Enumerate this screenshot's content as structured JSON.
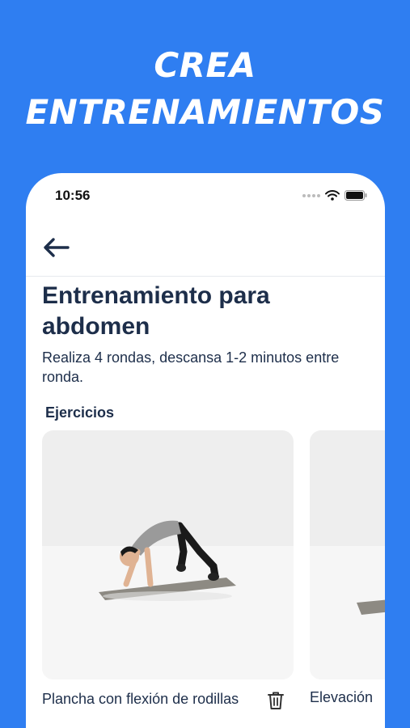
{
  "promo": {
    "line1": "CREA",
    "line2": "ENTRENAMIENTOS"
  },
  "status_bar": {
    "time": "10:56"
  },
  "workout": {
    "title": "Entrenamiento para abdomen",
    "description": "Realiza 4 rondas, descansa 1-2 minutos entre ronda.",
    "section_label": "Ejercicios",
    "exercises": [
      {
        "name": "Plancha con flexión de rodillas"
      },
      {
        "name": "Elevación"
      }
    ]
  },
  "colors": {
    "background": "#2f7ef1",
    "text_dark": "#1d2e4a",
    "accent": "#2f7ef1"
  },
  "icons": [
    "back-arrow-icon",
    "wifi-icon",
    "battery-icon",
    "trash-icon"
  ]
}
